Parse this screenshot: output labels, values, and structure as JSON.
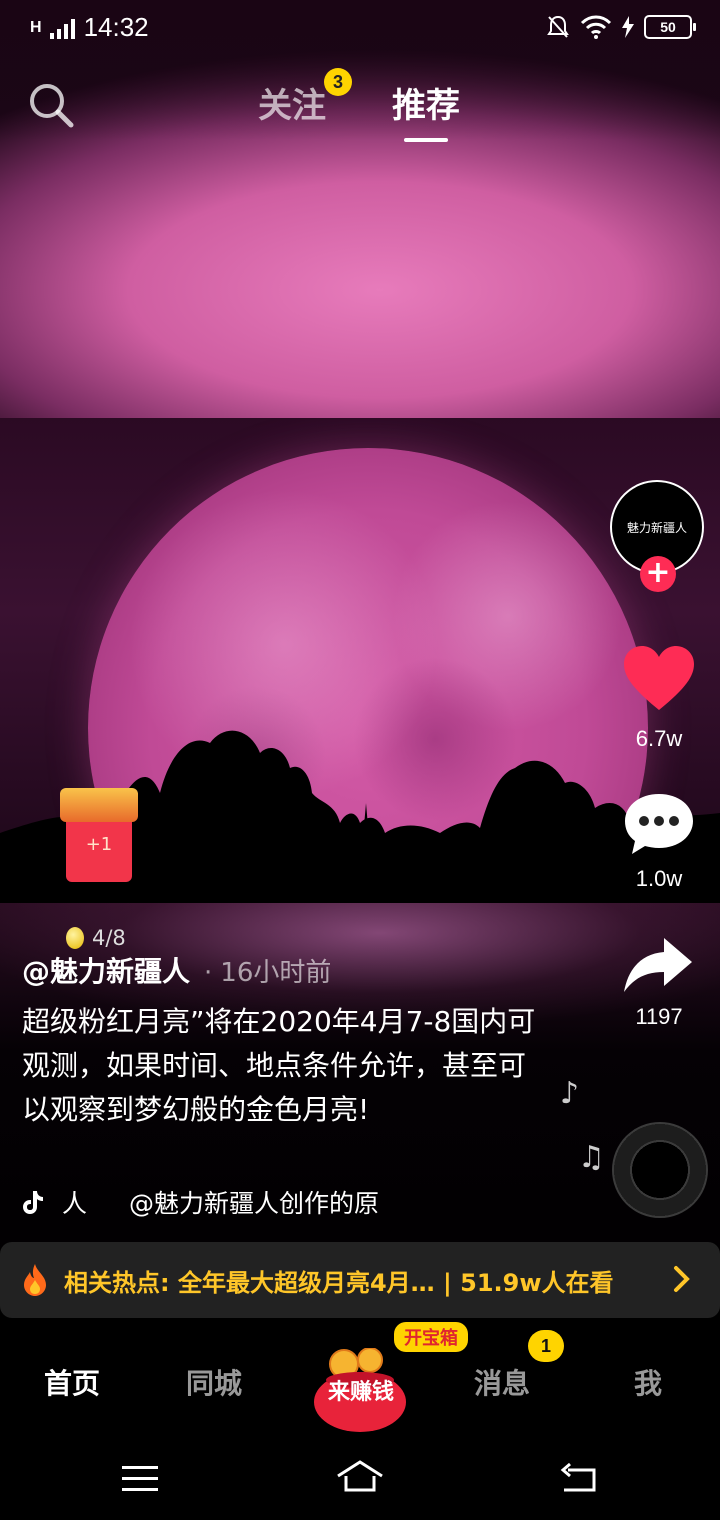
{
  "status_bar": {
    "network": "H",
    "time": "14:32",
    "battery": "50"
  },
  "top_tabs": {
    "follow_label": "关注",
    "follow_badge": "3",
    "recommend_label": "推荐"
  },
  "right_rail": {
    "avatar_text": "魅力新疆人",
    "follow_plus": "+",
    "likes": "6.7w",
    "comments": "1.0w",
    "shares": "1197"
  },
  "red_packet": {
    "label": "+1",
    "coins_progress": "4/8"
  },
  "post": {
    "author": "@魅力新疆人",
    "separator": "·",
    "posted_time": "16小时前",
    "description": "超级粉红月亮”将在2020年4月7-8国内可观测，如果时间、地点条件允许，甚至可以观察到梦幻般的金色月亮!",
    "music_part1": "人",
    "music_part2": "@魅力新疆人创作的原"
  },
  "hot_topic": {
    "text": "相关热点: 全年最大超级月亮4月… | 51.9w人在看"
  },
  "bottom_nav": {
    "home": "首页",
    "city": "同城",
    "earn": "来赚钱",
    "chest": "开宝箱",
    "messages": "消息",
    "messages_badge": "1",
    "me": "我"
  },
  "colors": {
    "like_red": "#fe2c55",
    "accent_yellow": "#ffd400",
    "hot_text": "#ffc629"
  }
}
